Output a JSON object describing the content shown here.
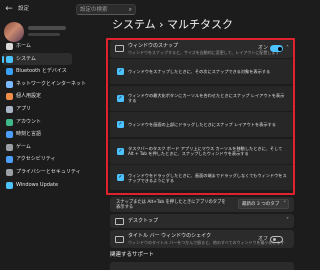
{
  "app": {
    "title": "設定"
  },
  "search": {
    "placeholder": "設定の検索"
  },
  "page": {
    "title": "システム  ›  マルチタスク"
  },
  "sidebar": {
    "items": [
      {
        "label": "ホーム",
        "icon": "home-icon",
        "color": "#d9d9d9"
      },
      {
        "label": "システム",
        "icon": "monitor-icon",
        "color": "#4cc2ff",
        "active": true
      },
      {
        "label": "Bluetooth とデバイス",
        "icon": "bluetooth-icon",
        "color": "#3aa0ff"
      },
      {
        "label": "ネットワークとインターネット",
        "icon": "wifi-icon",
        "color": "#7ab8ff"
      },
      {
        "label": "個人用設定",
        "icon": "brush-icon",
        "color": "#f08c4a"
      },
      {
        "label": "アプリ",
        "icon": "apps-icon",
        "color": "#a9b4c7"
      },
      {
        "label": "アカウント",
        "icon": "account-icon",
        "color": "#3fb98a"
      },
      {
        "label": "時刻と言語",
        "icon": "globe-clock-icon",
        "color": "#4c9fff"
      },
      {
        "label": "ゲーム",
        "icon": "gamepad-icon",
        "color": "#9aa0a6"
      },
      {
        "label": "アクセシビリティ",
        "icon": "accessibility-icon",
        "color": "#4c9fff"
      },
      {
        "label": "プライバシーとセキュリティ",
        "icon": "shield-icon",
        "color": "#9aa0a6"
      },
      {
        "label": "Windows Update",
        "icon": "update-icon",
        "color": "#4cc2ff"
      }
    ]
  },
  "snap": {
    "title": "ウィンドウのスナップ",
    "description": "ウィンドウをスナップすると、サイズを自動的に変更して、レイアウトに配置します",
    "toggle_state": "オン",
    "enabled": true,
    "options": [
      {
        "lines": [
          "ウィンドウをスナップしたときに、その次にスナップできる対象を表示する"
        ],
        "checked": true
      },
      {
        "lines": [
          "ウィンドウの最大化ボタンにカーソルを合わせたときにスナップ レイアウトを表示",
          "する"
        ],
        "checked": true
      },
      {
        "lines": [
          "ウィンドウを画面の上部にドラッグしたときにスナップ レイアウトを表示する"
        ],
        "checked": true
      },
      {
        "lines": [
          "タスクバーのタスク ボード アプリ上にマウス カーソルを移動したときに、そして",
          "Alt + Tab を押したときに、スナップしたウィンドウを表示する"
        ],
        "checked": true
      },
      {
        "lines": [
          "ウィンドウをドラッグしたときに、画面の端までドラッグしなくてもウィンドウをス",
          "ナップできるようにする"
        ],
        "checked": true
      }
    ]
  },
  "alt_tab": {
    "label": "スナップまたは Alt+Tab を押したときにアプリのタブを",
    "label2": "表示する",
    "dropdown_value": "最新の 3 つのタブ"
  },
  "desktops": {
    "label": "デスクトップ"
  },
  "title_shake": {
    "title": "タイトル バー ウィンドウのシェイク",
    "description": "ウィンドウのタイトル バーをつかんで振ると、他のすべてのウィンドウを最小化します",
    "toggle_state": "オフ",
    "enabled": false
  },
  "related": {
    "title": "関連するサポート"
  }
}
